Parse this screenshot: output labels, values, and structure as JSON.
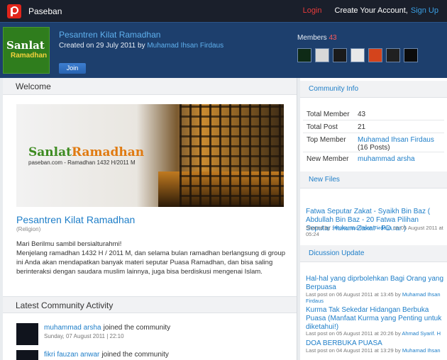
{
  "topbar": {
    "brand": "Paseban",
    "login": "Login",
    "create_account": "Create Your Account,",
    "sign_up": "Sign Up"
  },
  "header": {
    "thumb_line1": "Sanlat",
    "thumb_line2": "Ramadhan",
    "title": "Pesantren Kilat Ramadhan",
    "created_prefix": "Created on 29 July 2011 by",
    "created_by": "Muhamad Ihsan Firdaus",
    "join_label": "Join",
    "members_label": "Members",
    "members_count": "43",
    "avatar_colors": [
      "#0e2a16",
      "#d8d8d8",
      "#1a1a1a",
      "#e8e8e8",
      "#d4441c",
      "#202020",
      "#0b0b0b"
    ]
  },
  "main": {
    "welcome_heading": "Welcome",
    "banner_title_green": "Sanlat",
    "banner_title_orange": "Ramadhan",
    "banner_sub": "paseban.com - Ramadhan 1432 H/2011 M",
    "community_title": "Pesantren Kilat Ramadhan",
    "category": "(Religion)",
    "desc_line1": "Mari Berilmu sambil bersialturahmi!",
    "desc_line2": "Menjelang ramadhan 1432 H / 2011 M, dan selama bulan ramadhan berlangsung di group ini Anda akan mendapatkan banyak materi seputar Puasa Ramadhan, dan bisa saling berinteraksi dengan saudara muslim lainnya, juga bisa berdiskusi mengenai Islam.",
    "activity_heading": "Latest Community Activity",
    "activities": [
      {
        "name": "muhammad arsha",
        "rest": "joined the community",
        "date": "Sunday, 07 August 2011 | 22:10"
      },
      {
        "name": "fikri fauzan anwar",
        "rest": "joined the community",
        "date": ""
      }
    ]
  },
  "side": {
    "info_heading": "Community Info",
    "total_member_label": "Total Member",
    "total_member_value": "43",
    "total_post_label": "Total Post",
    "total_post_value": "21",
    "top_member_label": "Top Member",
    "top_member_value": "Muhamad Ihsan Firdaus",
    "top_member_posts": "(16 Posts)",
    "new_member_label": "New Member",
    "new_member_value": "muhammad arsha",
    "files_heading": "New Files",
    "file_title": "Fatwa Seputar Zakat - Syaikh Bin Baz ( Abdullah Bin Baz - 20 Fatwa Pilihan Seputar Hukum Zakat - PD.rar )",
    "file_meta_prefix": "Shared by :",
    "file_meta_user": "Muhamad Ihsan Firdaus",
    "file_meta_date": "on 05 August 2011 at 05:24",
    "discussion_heading": "Dicussion Update",
    "discussions": [
      {
        "title": "Hal-hal yang diprbolehkan Bagi Orang yang Berpuasa",
        "meta_prefix": "Last post on 06 August 2011 at 13:45 by",
        "meta_user": "Muhamad Ihsan Firdaus"
      },
      {
        "title": "Kurma Tak Sekedar Hidangan Berbuka Puasa (Manfaat Kurma yang Penting untuk diketahui!)",
        "meta_prefix": "Last post on 05 August 2011 at 20:26 by",
        "meta_user": "Ahmad Syarif. H"
      },
      {
        "title": "DOA BERBUKA PUASA",
        "meta_prefix": "Last post on 04 August 2011 at 13:29 by",
        "meta_user": "Muhamad Ihsan"
      }
    ]
  }
}
